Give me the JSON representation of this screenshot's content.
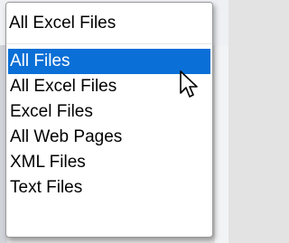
{
  "combo": {
    "value": "All Excel Files"
  },
  "options": [
    {
      "label": "All Files",
      "selected": true
    },
    {
      "label": "All Excel Files",
      "selected": false
    },
    {
      "label": "Excel Files",
      "selected": false
    },
    {
      "label": "All Web Pages",
      "selected": false
    },
    {
      "label": "XML Files",
      "selected": false
    },
    {
      "label": "Text Files",
      "selected": false
    }
  ],
  "colors": {
    "highlight": "#0a6fd6",
    "highlight_text": "#ffffff",
    "text": "#000000"
  },
  "cursor": {
    "icon": "arrow-pointer-icon"
  }
}
